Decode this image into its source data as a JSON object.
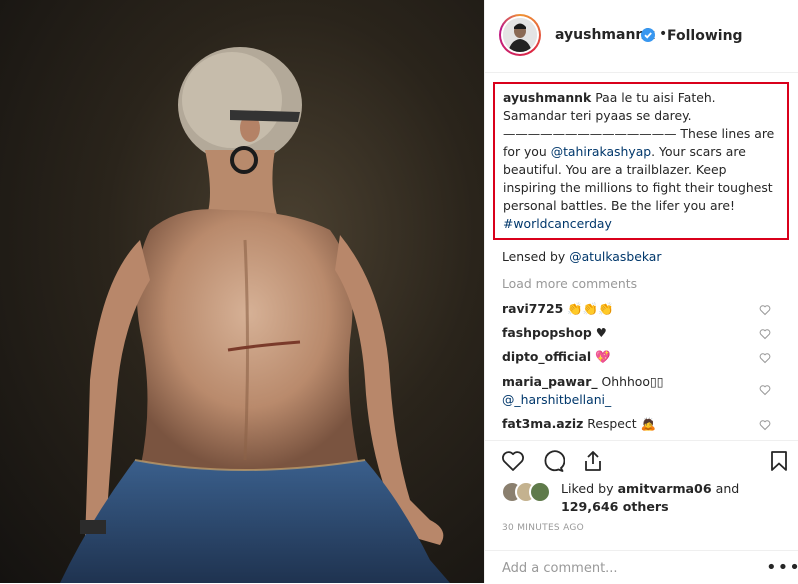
{
  "post": {
    "username": "ayushmannk",
    "follow_status": "Following",
    "separator": "•"
  },
  "caption": {
    "username": "ayushmannk",
    "line1": "Paa le tu aisi Fateh.",
    "line2": "Samandar teri pyaas se darey.",
    "line3": "—————————————— These lines are",
    "line4_prefix": "for you ",
    "mention": "@tahirakashyap",
    "line4_suffix": ". Your scars are",
    "line5": "beautiful. You are a trailblazer. Keep",
    "line6": "inspiring the millions to fight their toughest",
    "line7": "personal battles. Be the lifer you are!",
    "hashtag": "#worldcancerday"
  },
  "lensed": {
    "prefix": "Lensed by ",
    "mention": "@atulkasbekar"
  },
  "load_more": "Load more comments",
  "comments": [
    {
      "user": "ravi7725",
      "text": "👏👏👏"
    },
    {
      "user": "fashpopshop",
      "text": "♥"
    },
    {
      "user": "dipto_official",
      "text": "💖"
    },
    {
      "user": "maria_pawar_",
      "text": "Ohhhoo▯▯",
      "text2": "@_harshitbellani_"
    },
    {
      "user": "fat3ma.aziz",
      "text": "Respect 🙇"
    }
  ],
  "likes": {
    "prefix": "Liked by ",
    "user": "amitvarma06",
    "middle": " and",
    "count": "129,646 others"
  },
  "timestamp": "30 MINUTES AGO",
  "add_comment_placeholder": "Add a comment...",
  "more_dots": "•••",
  "icons": {
    "verified": "verified-badge-icon",
    "heart": "heart-icon",
    "comment": "comment-icon",
    "share": "share-icon",
    "save": "bookmark-icon"
  },
  "colors": {
    "highlight_border": "#d9001b",
    "link": "#00376b",
    "verified": "#3897f0"
  }
}
